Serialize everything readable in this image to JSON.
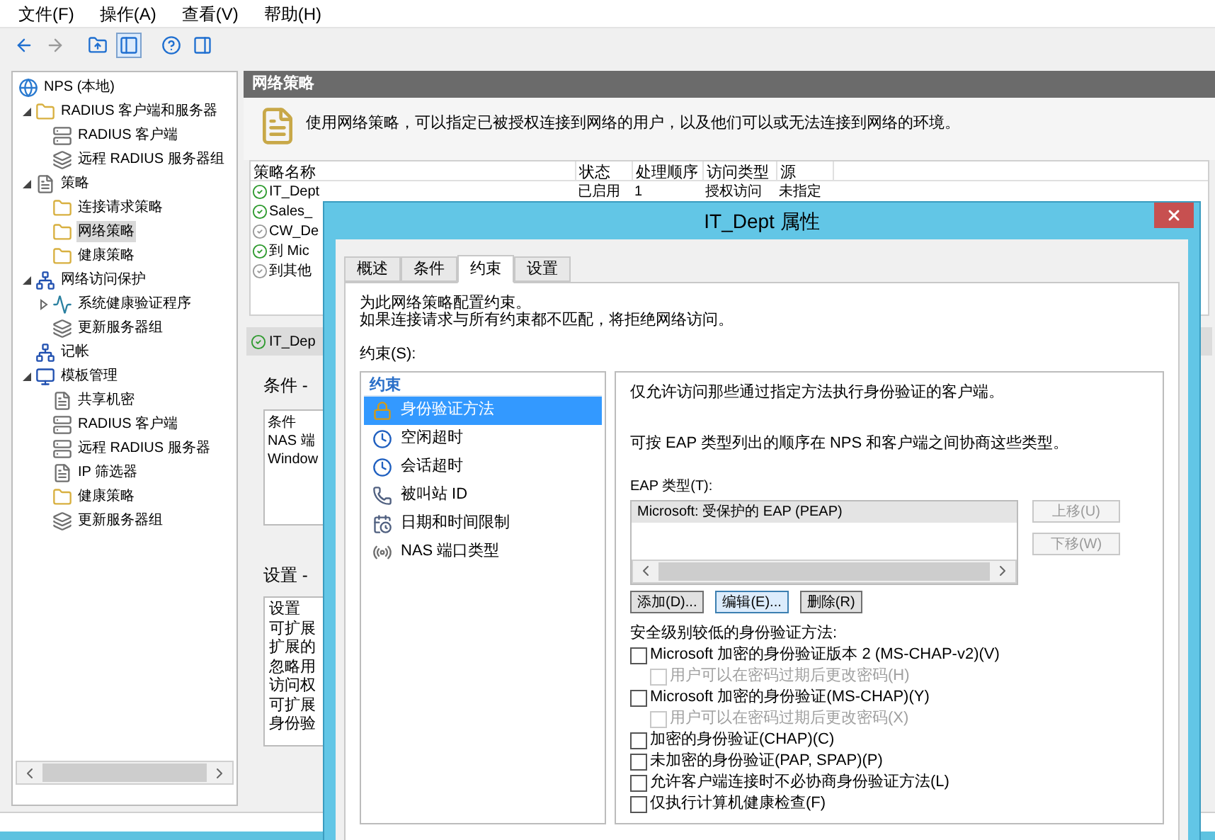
{
  "menu": [
    "文件(F)",
    "操作(A)",
    "查看(V)",
    "帮助(H)"
  ],
  "toolbar": [
    {
      "kind": "back",
      "disabled": false
    },
    {
      "kind": "forward",
      "disabled": true
    },
    {
      "kind": "up",
      "disabled": false
    },
    {
      "kind": "tree",
      "selected": true
    },
    {
      "kind": "help",
      "disabled": false
    },
    {
      "kind": "pane",
      "disabled": false
    }
  ],
  "tree": [
    {
      "label": "NPS (本地)",
      "kind": "globe",
      "selected": false,
      "children": [
        {
          "label": "RADIUS 客户端和服务器",
          "kind": "folder",
          "selected": false,
          "expanded": true,
          "children": [
            {
              "label": "RADIUS 客户端",
              "kind": "server",
              "selected": false
            },
            {
              "label": "远程 RADIUS 服务器组",
              "kind": "group",
              "selected": false
            }
          ]
        },
        {
          "label": "策略",
          "kind": "doc",
          "selected": false,
          "expanded": true,
          "children": [
            {
              "label": "连接请求策略",
              "kind": "folder",
              "selected": false
            },
            {
              "label": "网络策略",
              "kind": "folder",
              "selected": true
            },
            {
              "label": "健康策略",
              "kind": "folder",
              "selected": false
            }
          ]
        },
        {
          "label": "网络访问保护",
          "kind": "network",
          "selected": false,
          "expanded": true,
          "children": [
            {
              "label": "系统健康验证程序",
              "kind": "chart",
              "selected": false,
              "expanded": false
            },
            {
              "label": "更新服务器组",
              "kind": "group",
              "selected": false
            }
          ]
        },
        {
          "label": "记帐",
          "kind": "network",
          "selected": false
        },
        {
          "label": "模板管理",
          "kind": "monitor",
          "selected": false,
          "expanded": true,
          "children": [
            {
              "label": "共享机密",
              "kind": "doc",
              "selected": false
            },
            {
              "label": "RADIUS 客户端",
              "kind": "server",
              "selected": false
            },
            {
              "label": "远程 RADIUS 服务器",
              "kind": "server",
              "selected": false
            },
            {
              "label": "IP 筛选器",
              "kind": "doc",
              "selected": false
            },
            {
              "label": "健康策略",
              "kind": "folder",
              "selected": false
            },
            {
              "label": "更新服务器组",
              "kind": "group",
              "selected": false
            }
          ]
        }
      ]
    }
  ],
  "panel": {
    "title": "网络策略",
    "description": "使用网络策略，可以指定已被授权连接到网络的用户，以及他们可以或无法连接到网络的环境。",
    "columns": [
      "策略名称",
      "状态",
      "处理顺序",
      "访问类型",
      "源"
    ],
    "rows": [
      {
        "cells": [
          "IT_Dept",
          "已启用",
          "1",
          "授权访问",
          "未指定"
        ],
        "enabled": true
      },
      {
        "cells": [
          "Sales_"
        ],
        "enabled": true
      },
      {
        "cells": [
          "CW_De"
        ],
        "enabled": false
      },
      {
        "cells": [
          "到 Mic"
        ],
        "enabled": true
      },
      {
        "cells": [
          "到其他"
        ],
        "enabled": false
      }
    ],
    "detail_title": "IT_Dep",
    "conditions_label": "条件 -",
    "conditions_lines": [
      "条件",
      "NAS 端",
      "Window"
    ],
    "settings_label": "设置 -",
    "settings_lines": [
      "设置",
      "可扩展",
      "扩展的",
      "忽略用",
      "访问权",
      "可扩展",
      "身份验"
    ]
  },
  "dialog": {
    "title": "IT_Dept 属性",
    "tabs": [
      {
        "label": "概述",
        "selected": false
      },
      {
        "label": "条件",
        "selected": false
      },
      {
        "label": "约束",
        "selected": true
      },
      {
        "label": "设置",
        "selected": false
      }
    ],
    "intro": [
      "为此网络策略配置约束。",
      "如果连接请求与所有约束都不匹配，将拒绝网络访问。"
    ],
    "list_label": "约束(S):",
    "list_header": "约束",
    "constraints": [
      {
        "label": "身份验证方法",
        "kind": "lock",
        "selected": true
      },
      {
        "label": "空闲超时",
        "kind": "clock",
        "selected": false
      },
      {
        "label": "会话超时",
        "kind": "clock",
        "selected": false
      },
      {
        "label": "被叫站 ID",
        "kind": "phone",
        "selected": false
      },
      {
        "label": "日期和时间限制",
        "kind": "calendar",
        "selected": false
      },
      {
        "label": "NAS 端口类型",
        "kind": "antenna",
        "selected": false
      }
    ],
    "info1": "仅允许访问那些通过指定方法执行身份验证的客户端。",
    "info2": "可按 EAP 类型列出的顺序在 NPS 和客户端之间协商这些类型。",
    "eap_label": "EAP 类型(T):",
    "eap_items": [
      {
        "label": "Microsoft: 受保护的 EAP (PEAP)",
        "selected": true
      }
    ],
    "side_buttons": [
      {
        "label": "上移(U)",
        "disabled": true
      },
      {
        "label": "下移(W)",
        "disabled": true
      }
    ],
    "buttons": [
      {
        "label": "添加(D)...",
        "focused": false
      },
      {
        "label": "编辑(E)...",
        "focused": true
      },
      {
        "label": "删除(R)",
        "focused": false
      }
    ],
    "less_secure_label": "安全级别较低的身份验证方法:",
    "checks": [
      {
        "label": "Microsoft 加密的身份验证版本 2 (MS-CHAP-v2)(V)",
        "checked": false,
        "disabled": false,
        "children": [
          {
            "label": "用户可以在密码过期后更改密码(H)",
            "checked": false,
            "disabled": true
          }
        ]
      },
      {
        "label": "Microsoft 加密的身份验证(MS-CHAP)(Y)",
        "checked": false,
        "disabled": false,
        "children": [
          {
            "label": "用户可以在密码过期后更改密码(X)",
            "checked": false,
            "disabled": true
          }
        ]
      },
      {
        "label": "加密的身份验证(CHAP)(C)",
        "checked": false,
        "disabled": false
      },
      {
        "label": "未加密的身份验证(PAP, SPAP)(P)",
        "checked": false,
        "disabled": false
      },
      {
        "label": "允许客户端连接时不必协商身份验证方法(L)",
        "checked": false,
        "disabled": false
      },
      {
        "label": "仅执行计算机健康检查(F)",
        "checked": false,
        "disabled": false
      }
    ]
  }
}
